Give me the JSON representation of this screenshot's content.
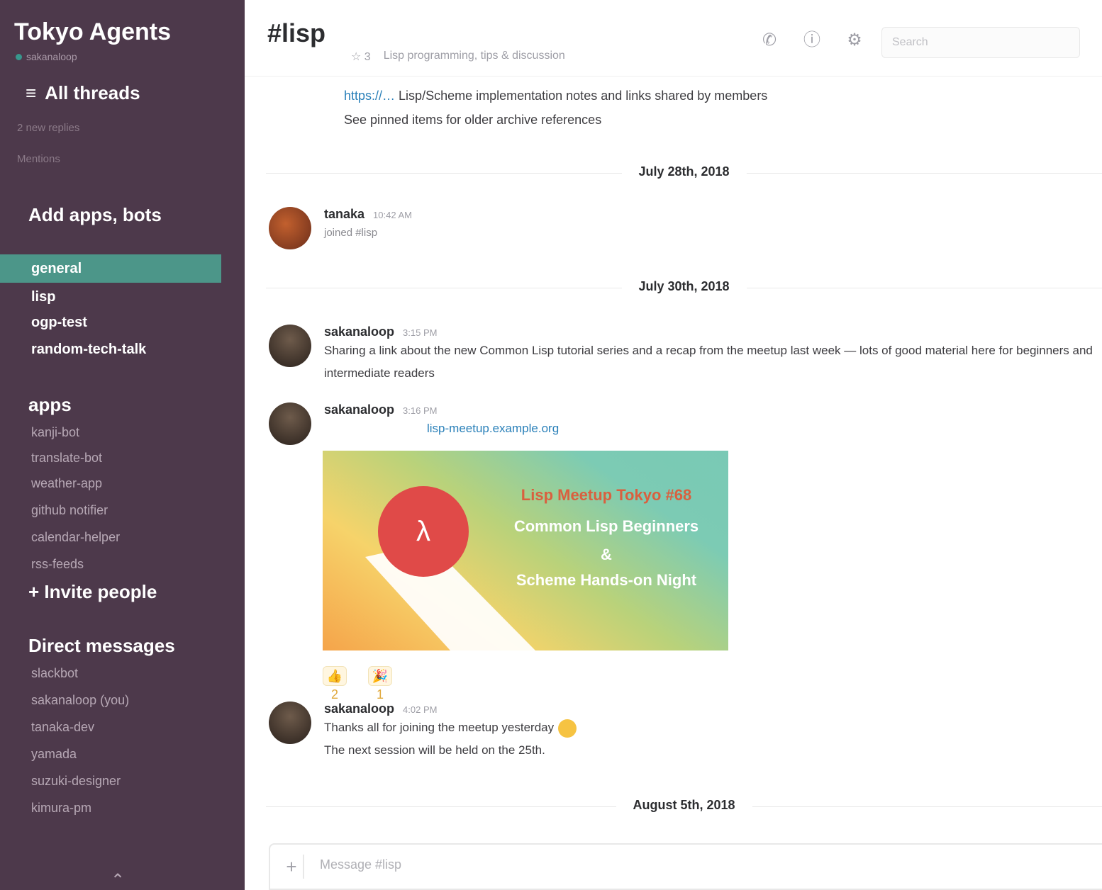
{
  "sidebar": {
    "team_name": "Tokyo Agents",
    "user_status": "sakanaloop",
    "top_link_threads": "All threads",
    "threads_meta": "2 new replies",
    "mentions_meta": "Mentions",
    "section_add_apps": "Add apps, bots",
    "channels": [
      {
        "name": "general",
        "active": true
      },
      {
        "name": "lisp"
      },
      {
        "name": "ogp-test"
      },
      {
        "name": "random-tech-talk"
      }
    ],
    "dm_section": "apps",
    "dms": [
      "kanji-bot",
      "translate-bot",
      "weather-app",
      "github notifier",
      "calendar-helper",
      "rss-feeds"
    ],
    "section_invite": "+ Invite people",
    "section_direct": "Direct messages",
    "people": [
      "slackbot",
      "sakanaloop (you)",
      "tanaka-dev",
      "yamada",
      "suzuki-designer",
      "kimura-pm"
    ],
    "bottom_icon": "expand-icon"
  },
  "header": {
    "channel_title": "#lisp",
    "meta_members": "☆ 3",
    "meta_topic": "Lisp programming, tips & discussion",
    "icons": [
      "phone-icon",
      "info-icon",
      "settings-icon"
    ],
    "search_placeholder": "Search"
  },
  "top_text": {
    "link_text": "https://…",
    "line1": "Lisp/Scheme implementation notes and links shared by members",
    "line2": "See pinned items for older archive references"
  },
  "dividers": [
    "July 28th, 2018",
    "July 30th, 2018",
    "August 5th, 2018"
  ],
  "messages": [
    {
      "user": "tanaka",
      "time": "10:42 AM",
      "text": "joined #lisp",
      "avatar": "orange"
    },
    {
      "user": "sakanaloop",
      "time": "3:15 PM",
      "text": "Sharing a link about the new Common Lisp tutorial series and a recap from the meetup last week — lots of good material here for beginners and",
      "text2": "intermediate readers",
      "avatar": "dark"
    },
    {
      "user": "sakanaloop",
      "time": "3:16 PM",
      "link": "lisp-meetup.example.org",
      "avatar": "dark"
    },
    {
      "user": "sakanaloop",
      "time": "4:02 PM",
      "text": "Thanks all for joining the meetup yesterday",
      "text2": "The next session will be held on the 25th.",
      "avatar": "dark"
    }
  ],
  "promo": {
    "badge": "λ",
    "line1": "Lisp Meetup Tokyo #68",
    "line2": "Common Lisp Beginners",
    "line3": "&",
    "line4": "Scheme Hands-on Night"
  },
  "reactions": [
    "👍 2",
    "🎉 1"
  ],
  "composer": {
    "plus": "+",
    "placeholder": "Message #lisp"
  },
  "colors": {
    "sidebar_bg": "#4d394b",
    "active_channel": "#4c9689",
    "link": "#2a80b9"
  }
}
